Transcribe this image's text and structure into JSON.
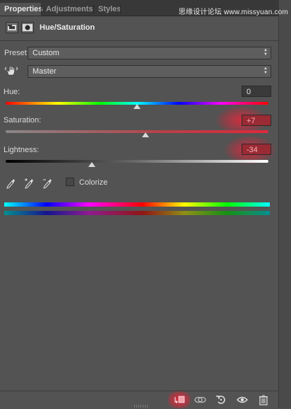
{
  "tabs": [
    {
      "label": "Properties",
      "active": true
    },
    {
      "label": "Adjustments",
      "active": false
    },
    {
      "label": "Styles",
      "active": false
    }
  ],
  "watermark": "思缘设计论坛 www.missyuan.com",
  "header": {
    "title": "Hue/Saturation",
    "icons": [
      "adjustment-layer-icon",
      "layer-mask-icon"
    ]
  },
  "preset": {
    "label": "Preset:",
    "value": "Custom"
  },
  "channel": {
    "value": "Master",
    "icon": "targeted-adjustment-hand-icon"
  },
  "hue": {
    "label": "Hue:",
    "value": "0"
  },
  "saturation": {
    "label": "Saturation:",
    "value": "+7"
  },
  "lightness": {
    "label": "Lightness:",
    "value": "-34"
  },
  "colorize": {
    "label": "Colorize",
    "checked": false
  },
  "eyedroppers": [
    "eyedropper-icon",
    "eyedropper-plus-icon",
    "eyedropper-minus-icon"
  ],
  "footer_icons": [
    "clip-to-layer-icon",
    "view-previous-state-icon",
    "reset-icon",
    "visibility-eye-icon",
    "trash-icon"
  ],
  "colors": {
    "panel": "#535353",
    "highlight": "#e0283c",
    "text": "#dcdcdc"
  }
}
